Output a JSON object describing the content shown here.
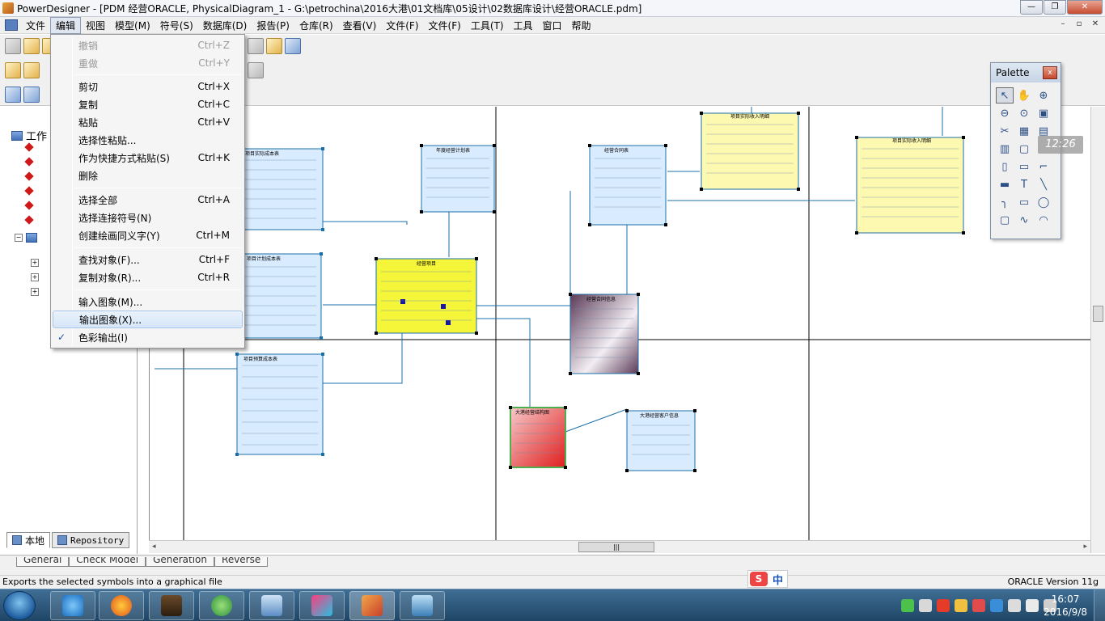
{
  "window": {
    "title": "PowerDesigner - [PDM 经营ORACLE, PhysicalDiagram_1 - G:\\petrochina\\2016大港\\01文档库\\05设计\\02数据库设计\\经营ORACLE.pdm]"
  },
  "menubar": {
    "items": [
      "文件",
      "编辑",
      "视图",
      "模型(M)",
      "符号(S)",
      "数据库(D)",
      "报告(P)",
      "仓库(R)",
      "查看(V)",
      "文件(F)",
      "文件(F)",
      "工具(T)",
      "工具",
      "窗口",
      "帮助"
    ]
  },
  "edit_menu": {
    "undo": {
      "label": "撤销",
      "shortcut": "Ctrl+Z"
    },
    "redo": {
      "label": "重做",
      "shortcut": "Ctrl+Y"
    },
    "cut": {
      "label": "剪切",
      "shortcut": "Ctrl+X"
    },
    "copy": {
      "label": "复制",
      "shortcut": "Ctrl+C"
    },
    "paste": {
      "label": "粘贴",
      "shortcut": "Ctrl+V"
    },
    "paste_special": {
      "label": "选择性粘贴..."
    },
    "paste_as_shortcut": {
      "label": "作为快捷方式粘贴(S)",
      "shortcut": "Ctrl+K"
    },
    "delete": {
      "label": "删除"
    },
    "select_all": {
      "label": "选择全部",
      "shortcut": "Ctrl+A"
    },
    "select_links": {
      "label": "选择连接符号(N)"
    },
    "create_synonym": {
      "label": "创建绘画同义字(Y)",
      "shortcut": "Ctrl+M"
    },
    "find": {
      "label": "查找对象(F)...",
      "shortcut": "Ctrl+F"
    },
    "duplicate": {
      "label": "复制对象(R)...",
      "shortcut": "Ctrl+R"
    },
    "import_image": {
      "label": "输入图象(M)..."
    },
    "export_image": {
      "label": "输出图象(X)..."
    },
    "color_output": {
      "label": "色彩输出(I)",
      "check": "✓"
    }
  },
  "browser": {
    "root_label": "工作",
    "tabs": {
      "local": "本地",
      "repository": "Repository"
    }
  },
  "palette": {
    "title": "Palette",
    "close": "x",
    "tools": [
      "↖",
      "✋",
      "⊕",
      "⊖",
      "⊙",
      "▣",
      "✂",
      "▦",
      "▤",
      "▥",
      "▢",
      "",
      "▯",
      "▭",
      "⌐",
      "▬",
      "T",
      "╲",
      "╮",
      "▭",
      "◯",
      "▢",
      "∿",
      "◠"
    ]
  },
  "clock_widget": "12:26",
  "output_tabs": [
    "General",
    "Check Model",
    "Generation",
    "Reverse"
  ],
  "statusbar": {
    "message": "Exports the selected symbols into a graphical file",
    "version": "ORACLE Version 11g"
  },
  "ime": {
    "logo": "S",
    "mode": "中"
  },
  "taskbar": {
    "time": "16:07",
    "date": "2016/9/8",
    "tasks": [
      "Internet Explorer",
      "Firefox",
      "Java EE IDE",
      "360 Browser",
      "Document Manager",
      "App",
      "PowerDesigner",
      "Image Viewer"
    ]
  },
  "diagram": {
    "tables": [
      {
        "name": "项目实际成本表",
        "fill": "#d9ecff"
      },
      {
        "name": "项目计划成本表",
        "fill": "#d9ecff"
      },
      {
        "name": "项目预算成本表",
        "fill": "#d9ecff"
      },
      {
        "name": "经营项目",
        "fill": "#f5f53a"
      },
      {
        "name": "年度经营计划表",
        "fill": "#d9ecff"
      },
      {
        "name": "经营合同表",
        "fill": "#d9ecff"
      },
      {
        "name": "项目实际收入明细",
        "fill": "#fdf9b0"
      },
      {
        "name": "项目实际收入明细",
        "fill": "#fdf9b0"
      },
      {
        "name": "经营合同信息",
        "fill": "#8b6a86"
      },
      {
        "name": "大港经营结构图",
        "fill": "#e03838"
      },
      {
        "name": "大港经营客户信息",
        "fill": "#d9ecff"
      }
    ]
  }
}
